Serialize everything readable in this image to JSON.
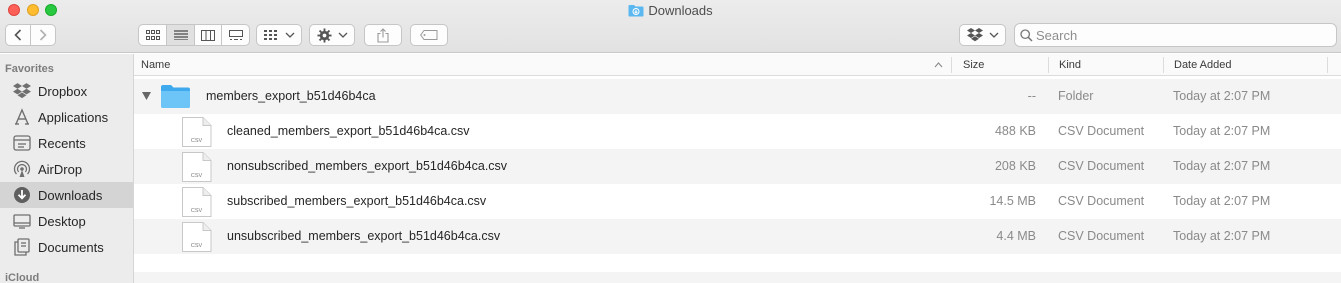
{
  "window": {
    "title": "Downloads"
  },
  "toolbar": {
    "search_placeholder": "Search"
  },
  "sidebar": {
    "sections": {
      "favorites": "Favorites",
      "icloud": "iCloud"
    },
    "items": [
      {
        "label": "Dropbox",
        "icon": "dropbox-icon"
      },
      {
        "label": "Applications",
        "icon": "applications-icon"
      },
      {
        "label": "Recents",
        "icon": "recents-icon"
      },
      {
        "label": "AirDrop",
        "icon": "airdrop-icon"
      },
      {
        "label": "Downloads",
        "icon": "downloads-icon",
        "selected": true
      },
      {
        "label": "Desktop",
        "icon": "desktop-icon"
      },
      {
        "label": "Documents",
        "icon": "documents-icon"
      }
    ]
  },
  "columns": {
    "name": "Name",
    "size": "Size",
    "kind": "Kind",
    "date_added": "Date Added"
  },
  "rows": [
    {
      "name": "members_export_b51d46b4ca",
      "size": "--",
      "kind": "Folder",
      "date_added": "Today at 2:07 PM",
      "type": "folder",
      "expanded": true
    },
    {
      "name": "cleaned_members_export_b51d46b4ca.csv",
      "size": "488 KB",
      "kind": "CSV Document",
      "date_added": "Today at 2:07 PM",
      "type": "csv",
      "file_badge": "CSV"
    },
    {
      "name": "nonsubscribed_members_export_b51d46b4ca.csv",
      "size": "208 KB",
      "kind": "CSV Document",
      "date_added": "Today at 2:07 PM",
      "type": "csv",
      "file_badge": "CSV"
    },
    {
      "name": "subscribed_members_export_b51d46b4ca.csv",
      "size": "14.5 MB",
      "kind": "CSV Document",
      "date_added": "Today at 2:07 PM",
      "type": "csv",
      "file_badge": "CSV"
    },
    {
      "name": "unsubscribed_members_export_b51d46b4ca.csv",
      "size": "4.4 MB",
      "kind": "CSV Document",
      "date_added": "Today at 2:07 PM",
      "type": "csv",
      "file_badge": "CSV"
    }
  ],
  "colors": {
    "folder_blue": "#5ab7f0",
    "selected_sidebar": "#d4d4d4",
    "close": "#fe5f57",
    "minimize": "#febc2e",
    "maximize": "#28c840"
  }
}
